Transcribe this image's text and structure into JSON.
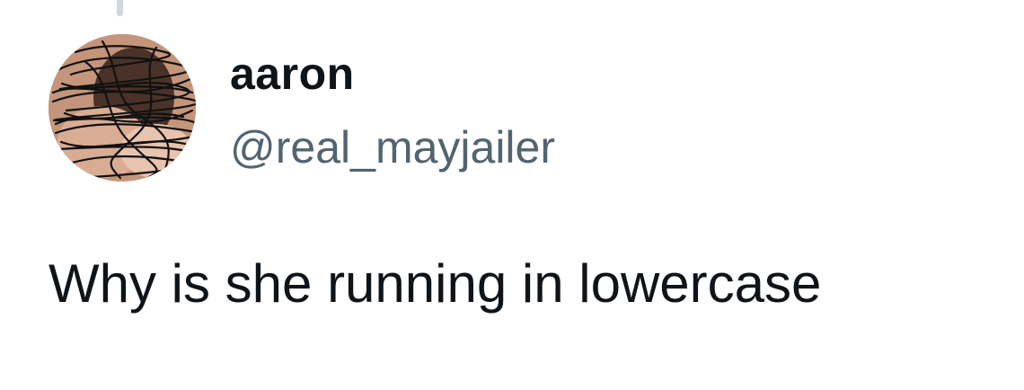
{
  "tweet": {
    "display_name": "aaron",
    "handle": "@real_mayjailer",
    "text": "Why is she running in lowercase",
    "avatar_icon": "scribbled-profile-photo"
  },
  "colors": {
    "primary_text": "#0f1419",
    "secondary_text": "#536471",
    "thread_line": "#cfd9de"
  }
}
